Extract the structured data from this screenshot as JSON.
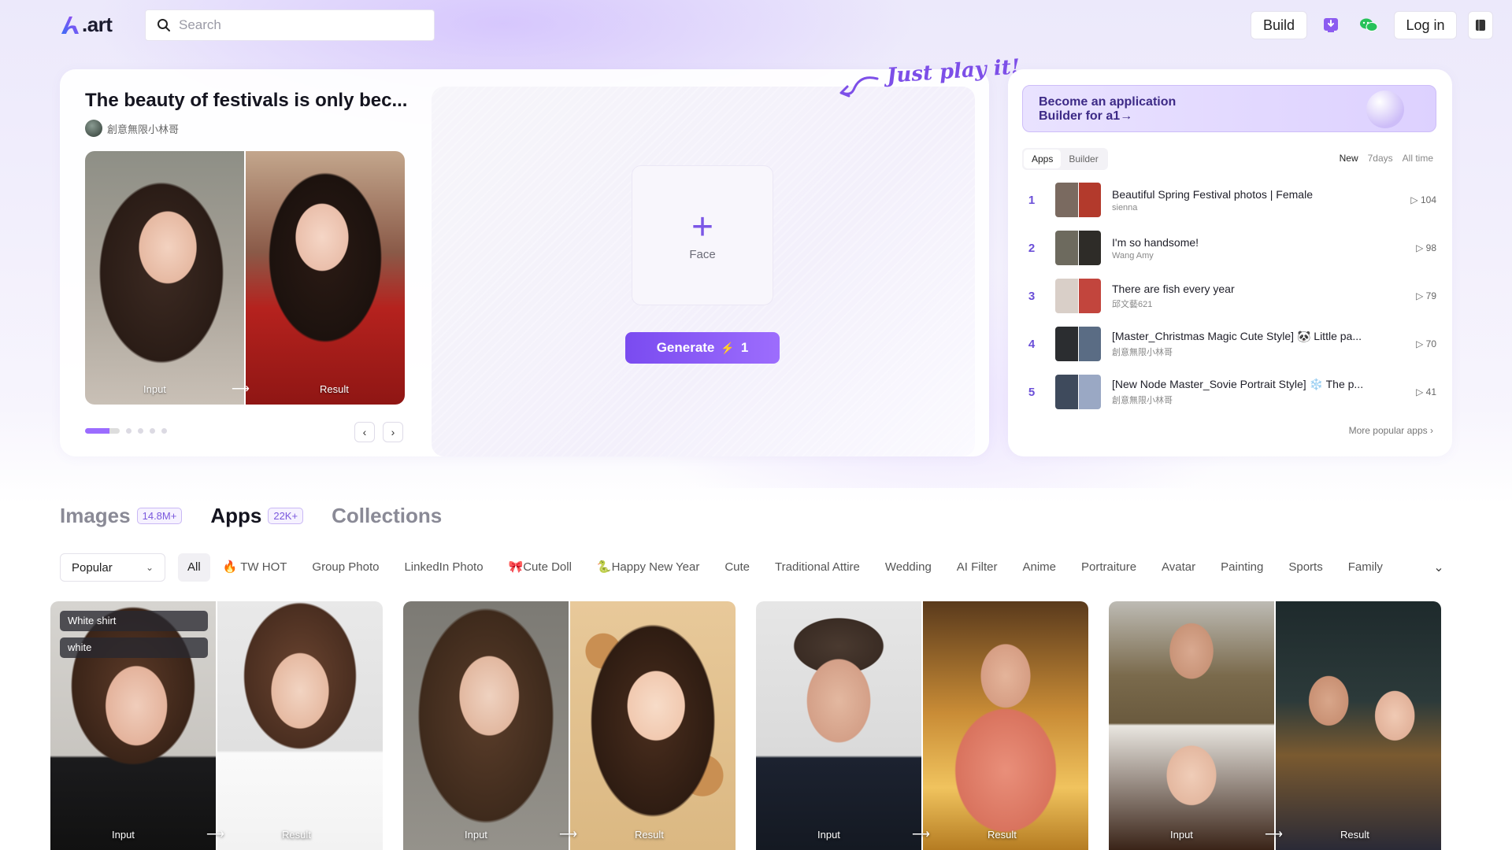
{
  "header": {
    "logo_text": ".art",
    "search_placeholder": "Search",
    "build_label": "Build",
    "login_label": "Log in"
  },
  "featured": {
    "title": "The beauty of festivals is only bec...",
    "author": "創意無限小林哥",
    "input_label": "Input",
    "result_label": "Result",
    "pages": 5,
    "active_page": 1
  },
  "playground": {
    "tagline": "Just play it!",
    "face_label": "Face",
    "generate_label": "Generate",
    "generate_cost": "1"
  },
  "sidebar": {
    "banner_text": "Become an application Builder for a1→",
    "tabs": [
      "Apps",
      "Builder"
    ],
    "active_tab": "Apps",
    "time_filters": [
      "New",
      "7days",
      "All time"
    ],
    "ranking": [
      {
        "rank": "1",
        "title": "Beautiful Spring Festival photos | Female",
        "author": "sienna",
        "plays": "104",
        "colors": [
          "#7a6a60",
          "#b33a2c"
        ]
      },
      {
        "rank": "2",
        "title": "I'm so handsome!",
        "author": "Wang Amy",
        "plays": "98",
        "colors": [
          "#6d6a5e",
          "#2e2c28"
        ]
      },
      {
        "rank": "3",
        "title": "There are fish every year",
        "author": "邱文藝621",
        "plays": "79",
        "colors": [
          "#d9cfc8",
          "#c2453d"
        ]
      },
      {
        "rank": "4",
        "title": "[Master_Christmas Magic Cute Style] 🐼 Little pa...",
        "author": "創意無限小林哥",
        "plays": "70",
        "colors": [
          "#2b2d30",
          "#5a6c84"
        ]
      },
      {
        "rank": "5",
        "title": "[New Node Master_Sovie Portrait Style] ❄️ The p...",
        "author": "創意無限小林哥",
        "plays": "41",
        "colors": [
          "#3e4a5c",
          "#9aa8c4"
        ]
      }
    ],
    "more_label": "More popular apps"
  },
  "explore": {
    "tabs": [
      {
        "label": "Images",
        "count": "14.8M+"
      },
      {
        "label": "Apps",
        "count": "22K+"
      },
      {
        "label": "Collections",
        "count": ""
      }
    ],
    "active_tab": "Apps",
    "sort_value": "Popular",
    "categories": [
      "All",
      "🔥 TW HOT",
      "Group Photo",
      "LinkedIn Photo",
      "🎀Cute Doll",
      "🐍Happy New Year",
      "Cute",
      "Traditional Attire",
      "Wedding",
      "AI Filter",
      "Anime",
      "Portraiture",
      "Avatar",
      "Painting",
      "Sports",
      "Family"
    ],
    "active_category": "All"
  },
  "apps": [
    {
      "input_label": "Input",
      "result_label": "Result",
      "tags": [
        "White shirt",
        "white"
      ]
    },
    {
      "input_label": "Input",
      "result_label": "Result",
      "tags": []
    },
    {
      "input_label": "Input",
      "result_label": "Result",
      "tags": []
    },
    {
      "input_label": "Input",
      "result_label": "Result",
      "tags": []
    }
  ],
  "colors": {
    "accent": "#7a4bf0",
    "accent_light": "#9d6dfd",
    "rank_number": "#6b4fd8"
  }
}
